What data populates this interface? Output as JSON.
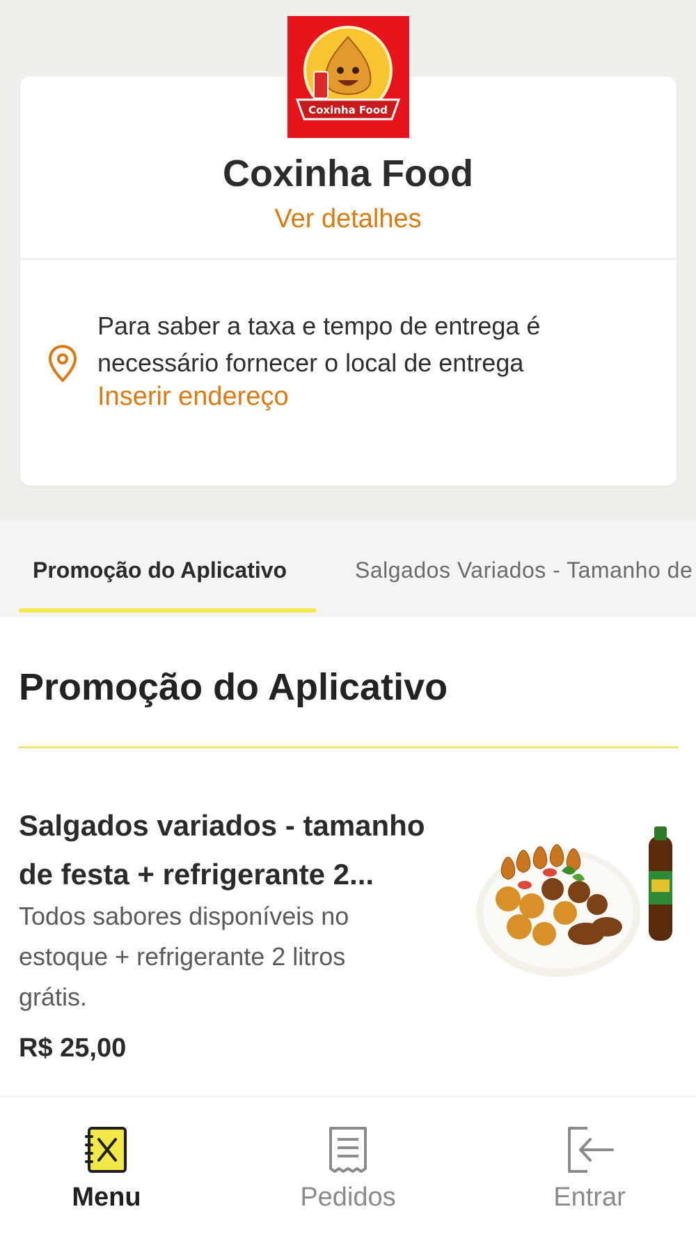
{
  "store": {
    "logo_text": "Coxinha Food",
    "name": "Coxinha Food",
    "details_link": "Ver detalhes"
  },
  "delivery": {
    "line1": "Para saber a taxa e tempo de entrega é",
    "line2": "necessário fornecer o local de entrega",
    "address_link": "Inserir endereço"
  },
  "tabs": [
    {
      "label": "Promoção do Aplicativo",
      "active": true
    },
    {
      "label": "Salgados Variados - Tamanho de Festa",
      "active": false
    }
  ],
  "section": {
    "title": "Promoção do Aplicativo"
  },
  "product": {
    "name_line1": "Salgados variados - tamanho",
    "name_line2": "de festa + refrigerante 2...",
    "desc_line1": "Todos sabores disponíveis no",
    "desc_line2": "estoque + refrigerante 2 litros",
    "desc_line3": "grátis.",
    "price": "R$ 25,00"
  },
  "bottom_nav": [
    {
      "label": "Menu",
      "icon": "menu-book-icon",
      "active": true
    },
    {
      "label": "Pedidos",
      "icon": "receipt-icon",
      "active": false
    },
    {
      "label": "Entrar",
      "icon": "login-icon",
      "active": false
    }
  ],
  "colors": {
    "accent_orange": "#d97a12",
    "accent_yellow": "#f2e84a",
    "logo_red": "#e8141c",
    "page_bg": "#f1efec"
  }
}
